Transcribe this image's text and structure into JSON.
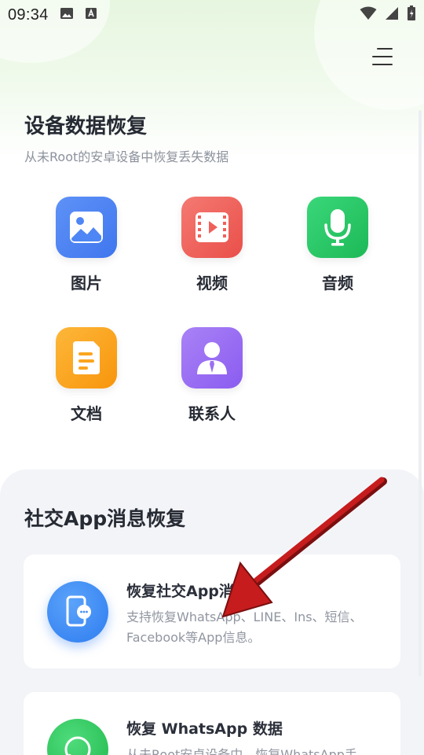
{
  "status_bar": {
    "time": "09:34"
  },
  "header": {
    "title": "设备数据恢复",
    "subtitle": "从未Root的安卓设备中恢复丢失数据"
  },
  "categories": [
    {
      "label": "图片",
      "icon": "image-icon",
      "color": "#4f86f5"
    },
    {
      "label": "视频",
      "icon": "video-icon",
      "color": "#f0605a"
    },
    {
      "label": "音频",
      "icon": "microphone-icon",
      "color": "#26c765"
    },
    {
      "label": "文档",
      "icon": "document-icon",
      "color": "#fba51f"
    },
    {
      "label": "联系人",
      "icon": "contact-icon",
      "color": "#9b6ff2"
    }
  ],
  "social_section": {
    "title": "社交App消息恢复",
    "cards": [
      {
        "title": "恢复社交App消息",
        "desc": "支持恢复WhatsApp、LINE、Ins、短信、Facebook等App信息。",
        "icon": "message-phone-icon",
        "color": "#3f8ef5"
      },
      {
        "title": "恢复 WhatsApp 数据",
        "desc": "从未Root安卓设备中，恢复WhatsApp手",
        "icon": "whatsapp-icon",
        "color": "#2ecc5f"
      }
    ]
  }
}
